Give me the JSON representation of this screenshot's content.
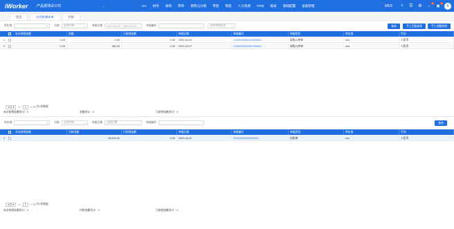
{
  "topbar": {
    "brand": "iWorker",
    "company": "产品部测试公司",
    "caret": "⌄",
    "nav": [
      "OA",
      "财务",
      "采购",
      "库存",
      "销售与分销",
      "零售",
      "制造",
      "人力资源",
      "CRM",
      "报表",
      "基础配置",
      "设备管理"
    ],
    "mes": "MES",
    "search_icon": "⌕",
    "menu_icon": "☰",
    "settings_icon": "⚙",
    "bell_icon": "🔔",
    "bell_badge": "8",
    "mail_icon": "✉",
    "mail_badge": "6",
    "avatar_text": "B",
    "accent": "#1f6fe0"
  },
  "tabs": [
    "首页",
    "应付款需求单",
    "付款"
  ],
  "filter1": {
    "label_company": "供应商",
    "search_icon": "⌕",
    "label_type": "付款",
    "type_value": "全部付款",
    "label_date": "单据日期",
    "date_value": "2020-03-25 ~ 2020-04-25",
    "label_number": "单据编号",
    "doctype_value": "全部单据类型",
    "query_button": "查询",
    "auto_button": "手工匹配核销",
    "manual_button": "手工调整核销"
  },
  "table1": {
    "headers": [
      "本次核销金额",
      "金额",
      "已核销金额",
      "单据日期",
      "单据编号",
      "单据类型",
      "供应商",
      "币别"
    ],
    "rows": [
      {
        "idx": "1",
        "cur": "0.00",
        "amt": "0.00",
        "done": "0.00",
        "date": "2020-04-20",
        "no": "CGWS20200420000001",
        "type": "采购入库单",
        "vendor": "ceo",
        "currency": "人民币"
      },
      {
        "idx": "2",
        "cur": "0.00",
        "amt": "380.20",
        "done": "0.00",
        "date": "2020-04-07",
        "no": "CGWS20200407000001",
        "type": "采购入库单",
        "vendor": "ceo",
        "currency": "人民币"
      }
    ]
  },
  "pager1": {
    "size": "100",
    "page": "1",
    "total": "共2条数据"
  },
  "totals1": {
    "current": "本次核销金额合计：0",
    "amount": "金额合计：0",
    "done": "已核销金额合计：0"
  },
  "filter2": {
    "label_company": "供应商",
    "search_icon": "⌕",
    "label_type": "付款",
    "type_value": "全部付款",
    "label_date": "单据日期",
    "date_value": "全部日期",
    "label_number": "单据编号",
    "query_button": "查询"
  },
  "table2": {
    "headers": [
      "本次核销金额",
      "付款金额",
      "已核销金额",
      "单据日期",
      "单据编号",
      "单据类型",
      "供应商",
      "币别"
    ],
    "rows": [
      {
        "idx": "1",
        "cur": "",
        "amt": "25,600.00",
        "done": "0.00",
        "date": "2020-04-20",
        "no": "FKD20200420000001",
        "type": "付款单",
        "vendor": "ceo",
        "currency": "人民币"
      }
    ]
  },
  "pager2": {
    "size": "100",
    "page": "1",
    "total": "共1条数据"
  },
  "totals2": {
    "current": "本次核销金额合计：0",
    "amount": "付款金额合计：0",
    "done": "已核销金额合计：0"
  }
}
